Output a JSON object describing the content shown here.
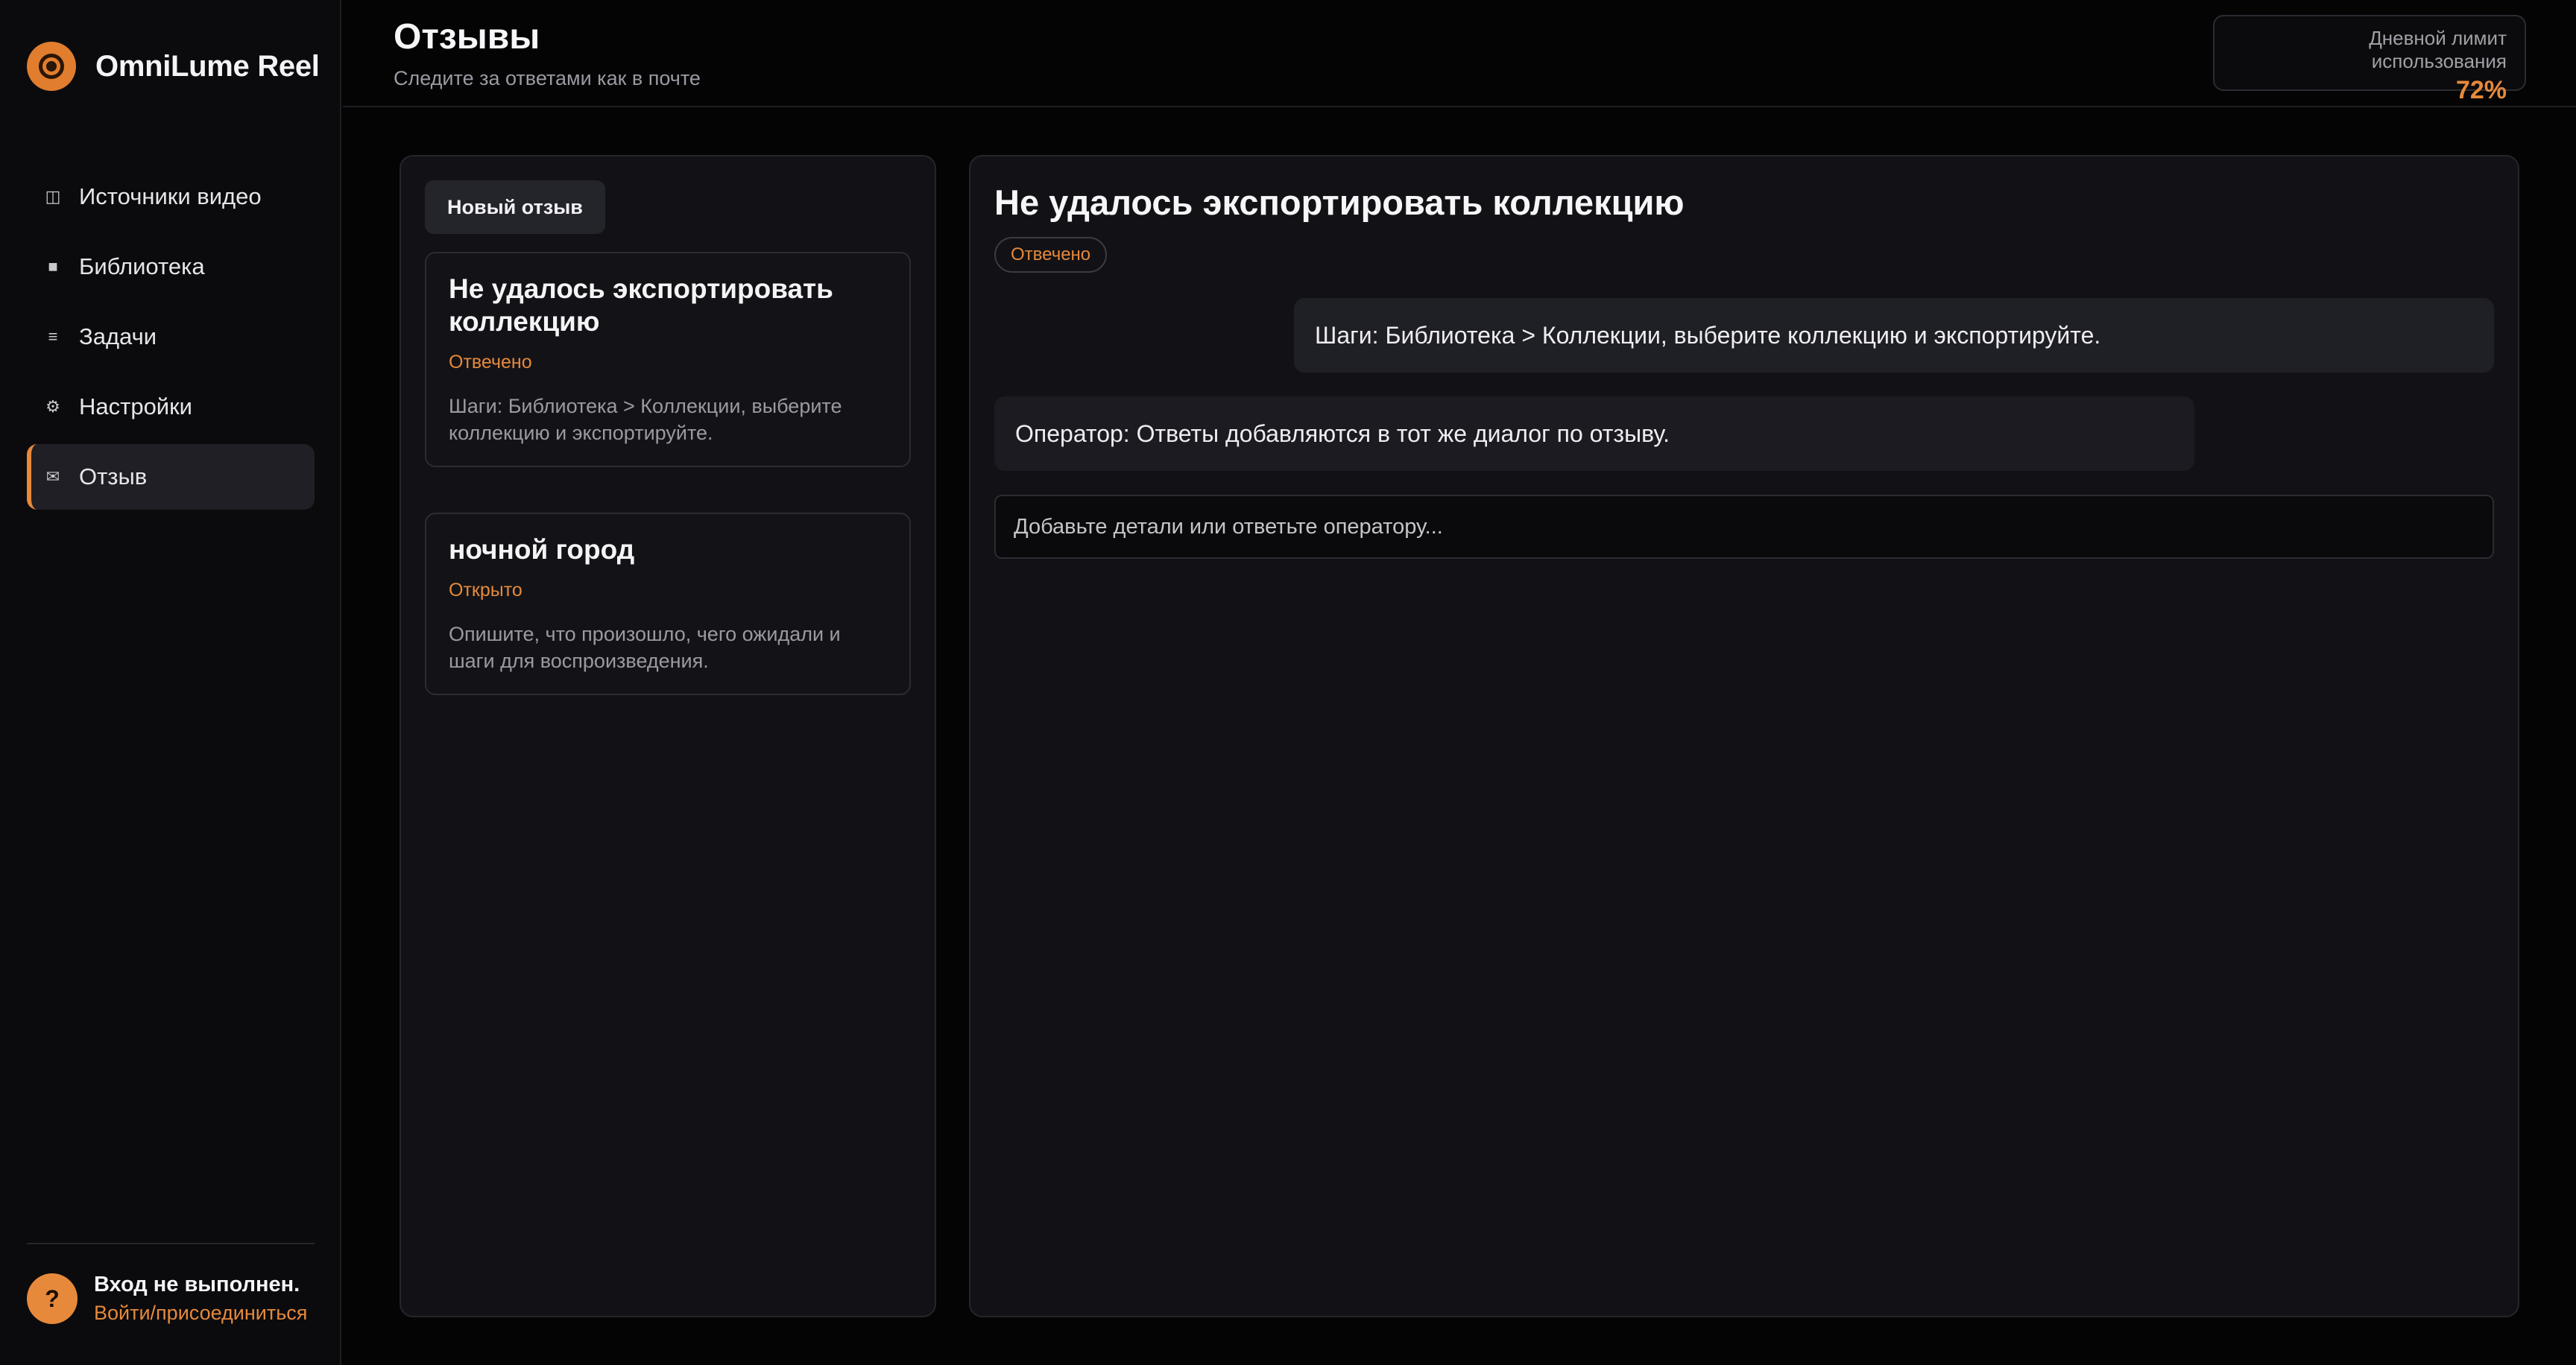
{
  "app": {
    "name": "OmniLume Reel",
    "logo_icon": "film-reel-icon",
    "accent_color": "#e6893b"
  },
  "sidebar": {
    "items": [
      {
        "label": "Источники видео",
        "icon": "columns-icon",
        "glyph": "◫",
        "active": false
      },
      {
        "label": "Библиотека",
        "icon": "square-icon",
        "glyph": "■",
        "active": false
      },
      {
        "label": "Задачи",
        "icon": "list-icon",
        "glyph": "≡",
        "active": false
      },
      {
        "label": "Настройки",
        "icon": "gear-icon",
        "glyph": "⚙",
        "active": false
      },
      {
        "label": "Отзыв",
        "icon": "envelope-icon",
        "glyph": "✉",
        "active": true
      }
    ],
    "user": {
      "avatar_glyph": "?",
      "status": "Вход не выполнен.",
      "link": "Войти/присоединиться"
    }
  },
  "header": {
    "title": "Отзывы",
    "subtitle": "Следите за ответами как в почте",
    "usage_label": "Дневной лимит использования",
    "usage_value": "72%",
    "usage_fraction": 0.72
  },
  "list": {
    "new_button": "Новый отзыв",
    "tickets": [
      {
        "title": "Не удалось экспортировать коллекцию",
        "status": "Отвечено",
        "snippet": "Шаги: Библиотека > Коллекции, выберите коллекцию и экспортируйте."
      },
      {
        "title": "ночной город",
        "status": "Открыто",
        "snippet": "Опишите, что произошло, чего ожидали и шаги для воспроизведения."
      }
    ]
  },
  "detail": {
    "title": "Не удалось экспортировать коллекцию",
    "status": "Отвечено",
    "messages": [
      {
        "author": "user",
        "text": "Шаги: Библиотека > Коллекции, выберите коллекцию и экспортируйте."
      },
      {
        "author": "operator",
        "text": "Оператор: Ответы добавляются в тот же диалог по отзыву."
      }
    ],
    "reply_placeholder": "Добавьте детали или ответьте оператору..."
  }
}
